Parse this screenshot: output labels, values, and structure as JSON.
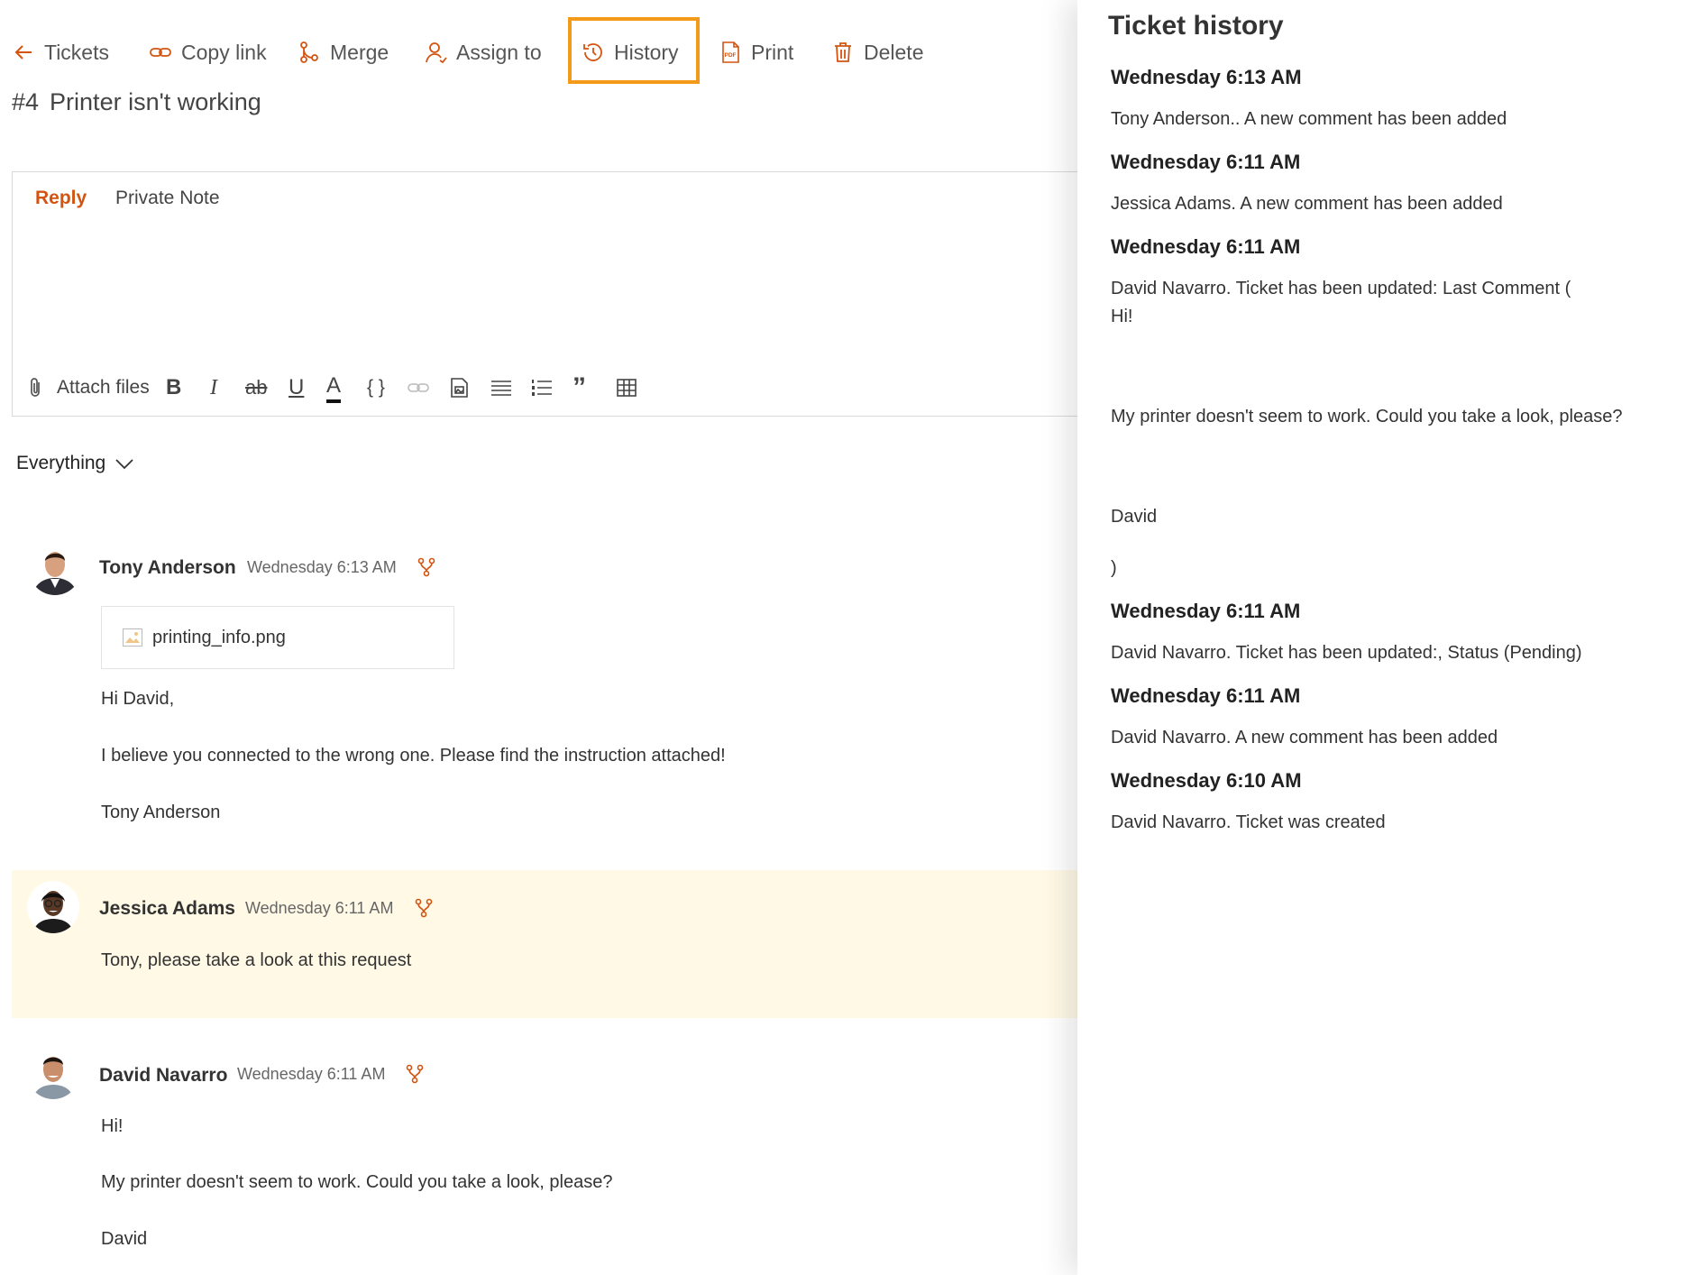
{
  "toolbar": {
    "tickets": "Tickets",
    "copy_link": "Copy link",
    "merge": "Merge",
    "assign_to": "Assign to",
    "history": "History",
    "print": "Print",
    "delete": "Delete"
  },
  "ticket": {
    "number": "#4",
    "title": "Printer isn't working"
  },
  "editor": {
    "tabs": {
      "reply": "Reply",
      "private_note": "Private Note"
    },
    "attach_files": "Attach files",
    "bold": "B",
    "italic": "I",
    "strike": "ab",
    "underline": "U",
    "font_color": "A",
    "code": "{ }",
    "quote": "”"
  },
  "filter": {
    "selected": "Everything"
  },
  "comments": [
    {
      "author": "Tony Anderson",
      "time": "Wednesday 6:13 AM",
      "attachment": "printing_info.png",
      "lines": [
        "Hi David,",
        "I believe you connected to the wrong one. Please find the instruction attached!",
        "Tony Anderson"
      ]
    },
    {
      "author": "Jessica Adams",
      "time": "Wednesday 6:11 AM",
      "lines": [
        "Tony, please take a look at this request"
      ]
    },
    {
      "author": "David Navarro",
      "time": "Wednesday 6:11 AM",
      "lines": [
        "Hi!",
        "My printer doesn't seem to work. Could you take a look, please?",
        "David"
      ]
    }
  ],
  "history": {
    "title": "Ticket history",
    "entries": [
      {
        "date": "Wednesday 6:13 AM",
        "text": "Tony Anderson.. A new comment has been added"
      },
      {
        "date": "Wednesday 6:11 AM",
        "text": "Jessica Adams. A new comment has been added"
      },
      {
        "date": "Wednesday 6:11 AM",
        "lines": [
          "David Navarro. Ticket has been updated: Last Comment (",
          "Hi!",
          "My printer doesn't seem to work. Could you take a look, please?",
          "David",
          ")"
        ]
      },
      {
        "date": "Wednesday 6:11 AM",
        "text": "David Navarro. Ticket has been updated:, Status (Pending)"
      },
      {
        "date": "Wednesday 6:11 AM",
        "text": "David Navarro. A new comment has been added"
      },
      {
        "date": "Wednesday 6:10 AM",
        "text": "David Navarro. Ticket was created"
      }
    ]
  },
  "colors": {
    "accent": "#d35411",
    "highlight": "#f39a1b",
    "note_bg": "#fff9e6"
  }
}
